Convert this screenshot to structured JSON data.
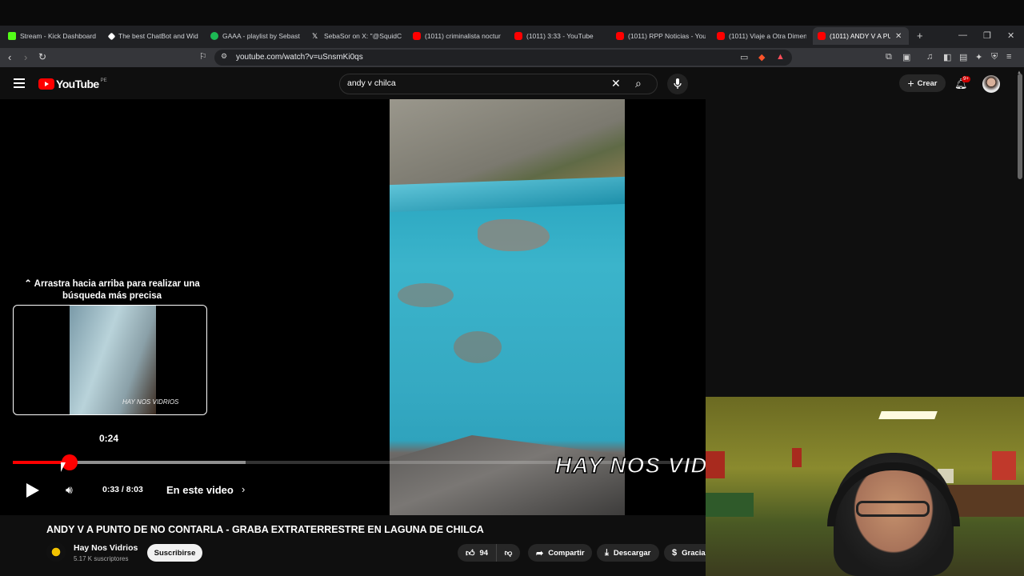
{
  "browser": {
    "tabs": [
      {
        "label": "Stream - Kick Dashboard",
        "color": "#53fc18"
      },
      {
        "label": "The best ChatBot and Wid",
        "color": "#ffffff"
      },
      {
        "label": "GAAA - playlist by Sebastia",
        "color": "#1db954"
      },
      {
        "label": "SebaSor on X: \"@SquidCra",
        "color": "#ffffff"
      },
      {
        "label": "(1011) criminalista noctur",
        "color": "#ff0000"
      },
      {
        "label": "(1011) 3:33 - YouTube",
        "color": "#ff0000"
      },
      {
        "label": "(1011) RPP Noticias - YouT",
        "color": "#ff0000"
      },
      {
        "label": "(1011) Viaje a Otra Dimens",
        "color": "#ff0000"
      },
      {
        "label": "(1011) ANDY V A PUN",
        "color": "#ff0000",
        "active": true
      }
    ],
    "url": "youtube.com/watch?v=uSnsmKi0qs",
    "new_tab": "+",
    "win_min": "—",
    "win_max": "❐",
    "win_close": "✕",
    "tab_close": "✕"
  },
  "youtube": {
    "logo": "YouTube",
    "country": "PE",
    "search_query": "andy v chilca",
    "create_label": "Crear",
    "notif_count": "9+"
  },
  "player": {
    "drag_hint": "Arrastra hacia arriba para realizar una búsqueda más precisa",
    "drag_hint_icon": "double-chevron-up-icon",
    "preview_time": "0:24",
    "preview_watermark": "HAY NOS VIDRIOS",
    "watermark": "HAY NOS VIDR",
    "time_display": "0:33 / 8:03",
    "chapters_label": "En este video",
    "progress": 0.082,
    "buffered": 0.336
  },
  "video": {
    "title": "ANDY V A PUNTO DE NO CONTARLA - GRABA EXTRATERRESTRE EN LAGUNA DE CHILCA",
    "channel": "Hay Nos Vidrios",
    "subscribers": "5.17 K suscriptores",
    "subscribe_label": "Suscribirse",
    "likes": "94",
    "share_label": "Compartir",
    "download_label": "Descargar",
    "thanks_label": "Gracias",
    "channel_avatar_text": "HAY NOS VIDRIOS"
  },
  "colors": {
    "accent": "#ff0000",
    "background": "#0f0f0f"
  }
}
